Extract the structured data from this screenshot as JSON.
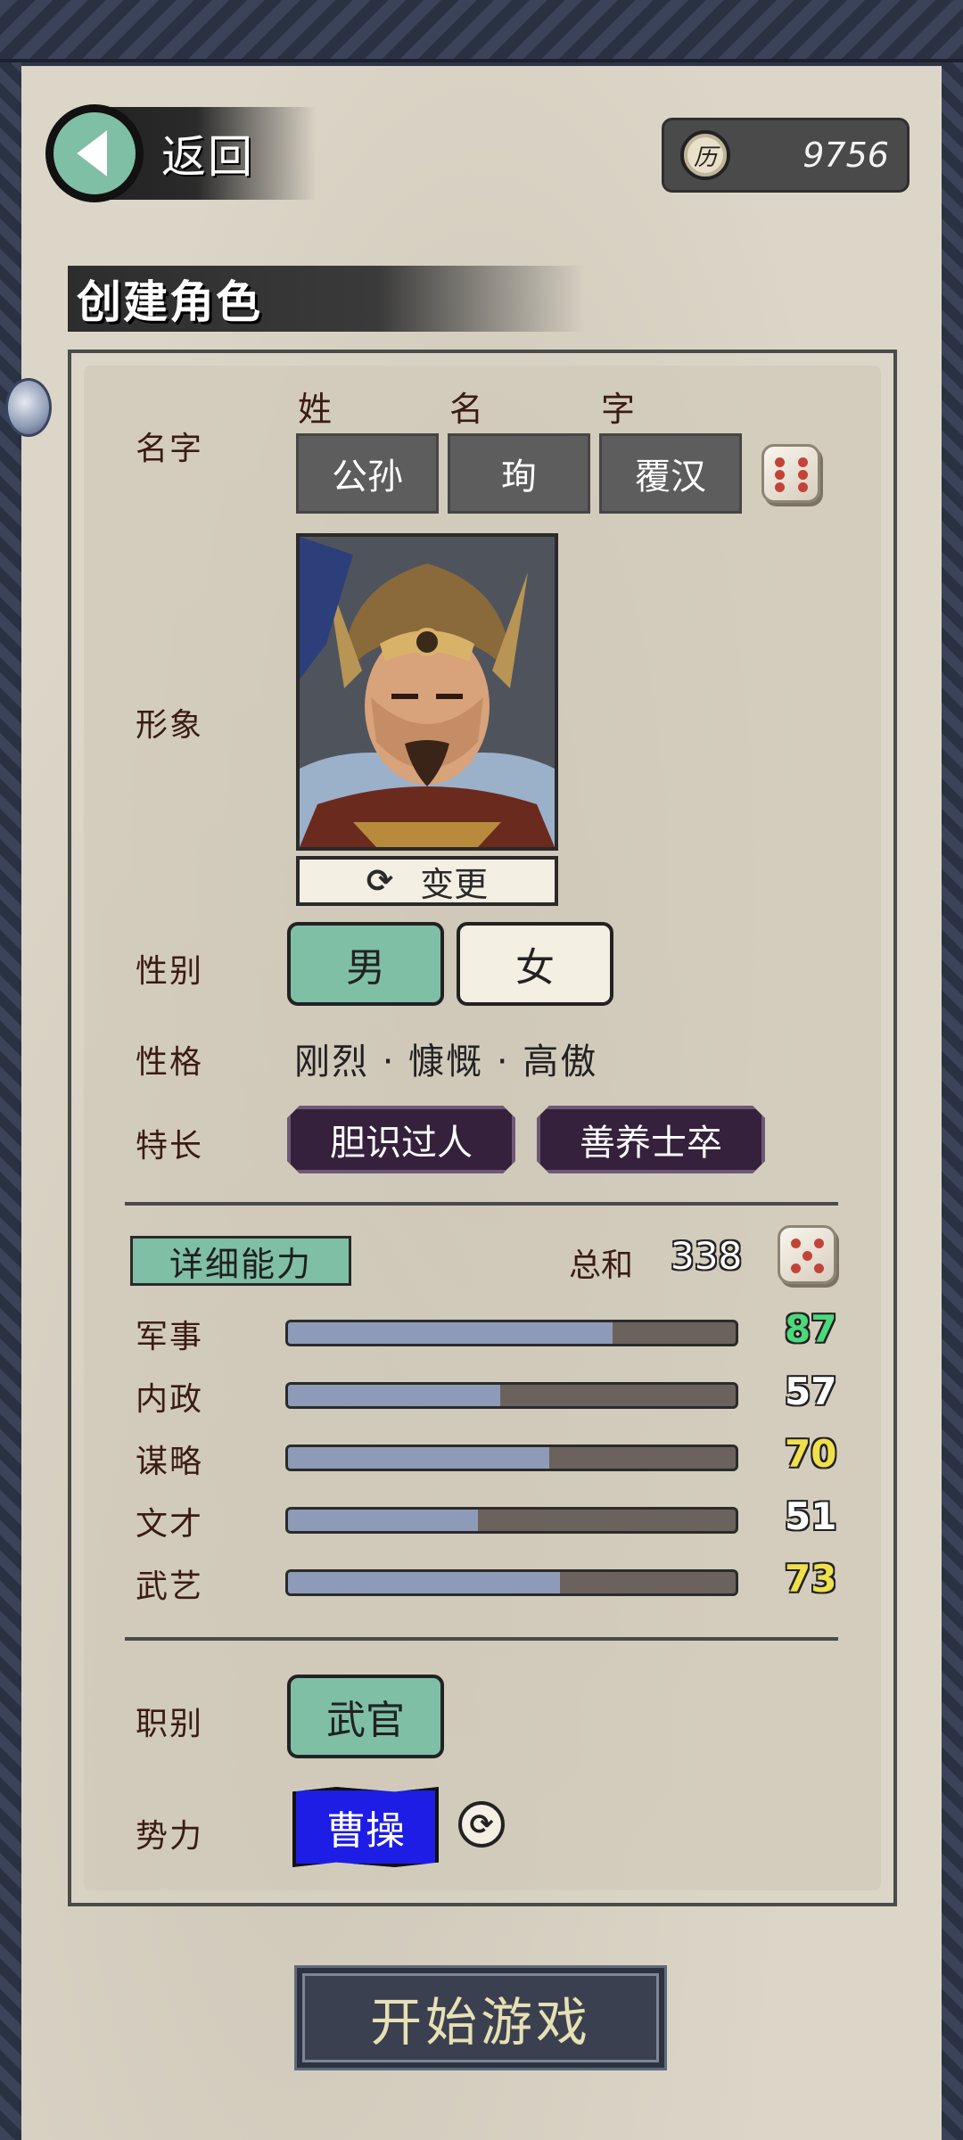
{
  "header": {
    "back_label": "返回",
    "currency_symbol": "历",
    "currency_amount": "9756",
    "section_title": "创建角色"
  },
  "name": {
    "label": "名字",
    "headers": [
      "姓",
      "名",
      "字"
    ],
    "surname": "公孙",
    "given_name": "珣",
    "courtesy_name": "覆汉"
  },
  "portrait": {
    "label": "形象",
    "change_label": "变更"
  },
  "gender": {
    "label": "性别",
    "male": "男",
    "female": "女",
    "selected": "男"
  },
  "personality": {
    "label": "性格",
    "text": "刚烈 · 慷慨 · 高傲"
  },
  "specialty": {
    "label": "特长",
    "items": [
      "胆识过人",
      "善养士卒"
    ]
  },
  "abilities": {
    "title": "详细能力",
    "total_label": "总和",
    "total": "338",
    "stats": [
      {
        "label": "军事",
        "value": 87,
        "display": "87",
        "color": "#4cd97b"
      },
      {
        "label": "内政",
        "value": 57,
        "display": "57",
        "color": "#ffffff"
      },
      {
        "label": "谋略",
        "value": 70,
        "display": "70",
        "color": "#f0e04a"
      },
      {
        "label": "文才",
        "value": 51,
        "display": "51",
        "color": "#ffffff"
      },
      {
        "label": "武艺",
        "value": 73,
        "display": "73",
        "color": "#f0e04a"
      }
    ],
    "max": 120
  },
  "role": {
    "label": "职别",
    "value": "武官"
  },
  "faction": {
    "label": "势力",
    "value": "曹操",
    "color": "#1d1de6"
  },
  "start_button": "开始游戏",
  "colors": {
    "accent_teal": "#7fbfa6",
    "specialty_bg": "#35213c",
    "paper": "#dcd6c8"
  }
}
